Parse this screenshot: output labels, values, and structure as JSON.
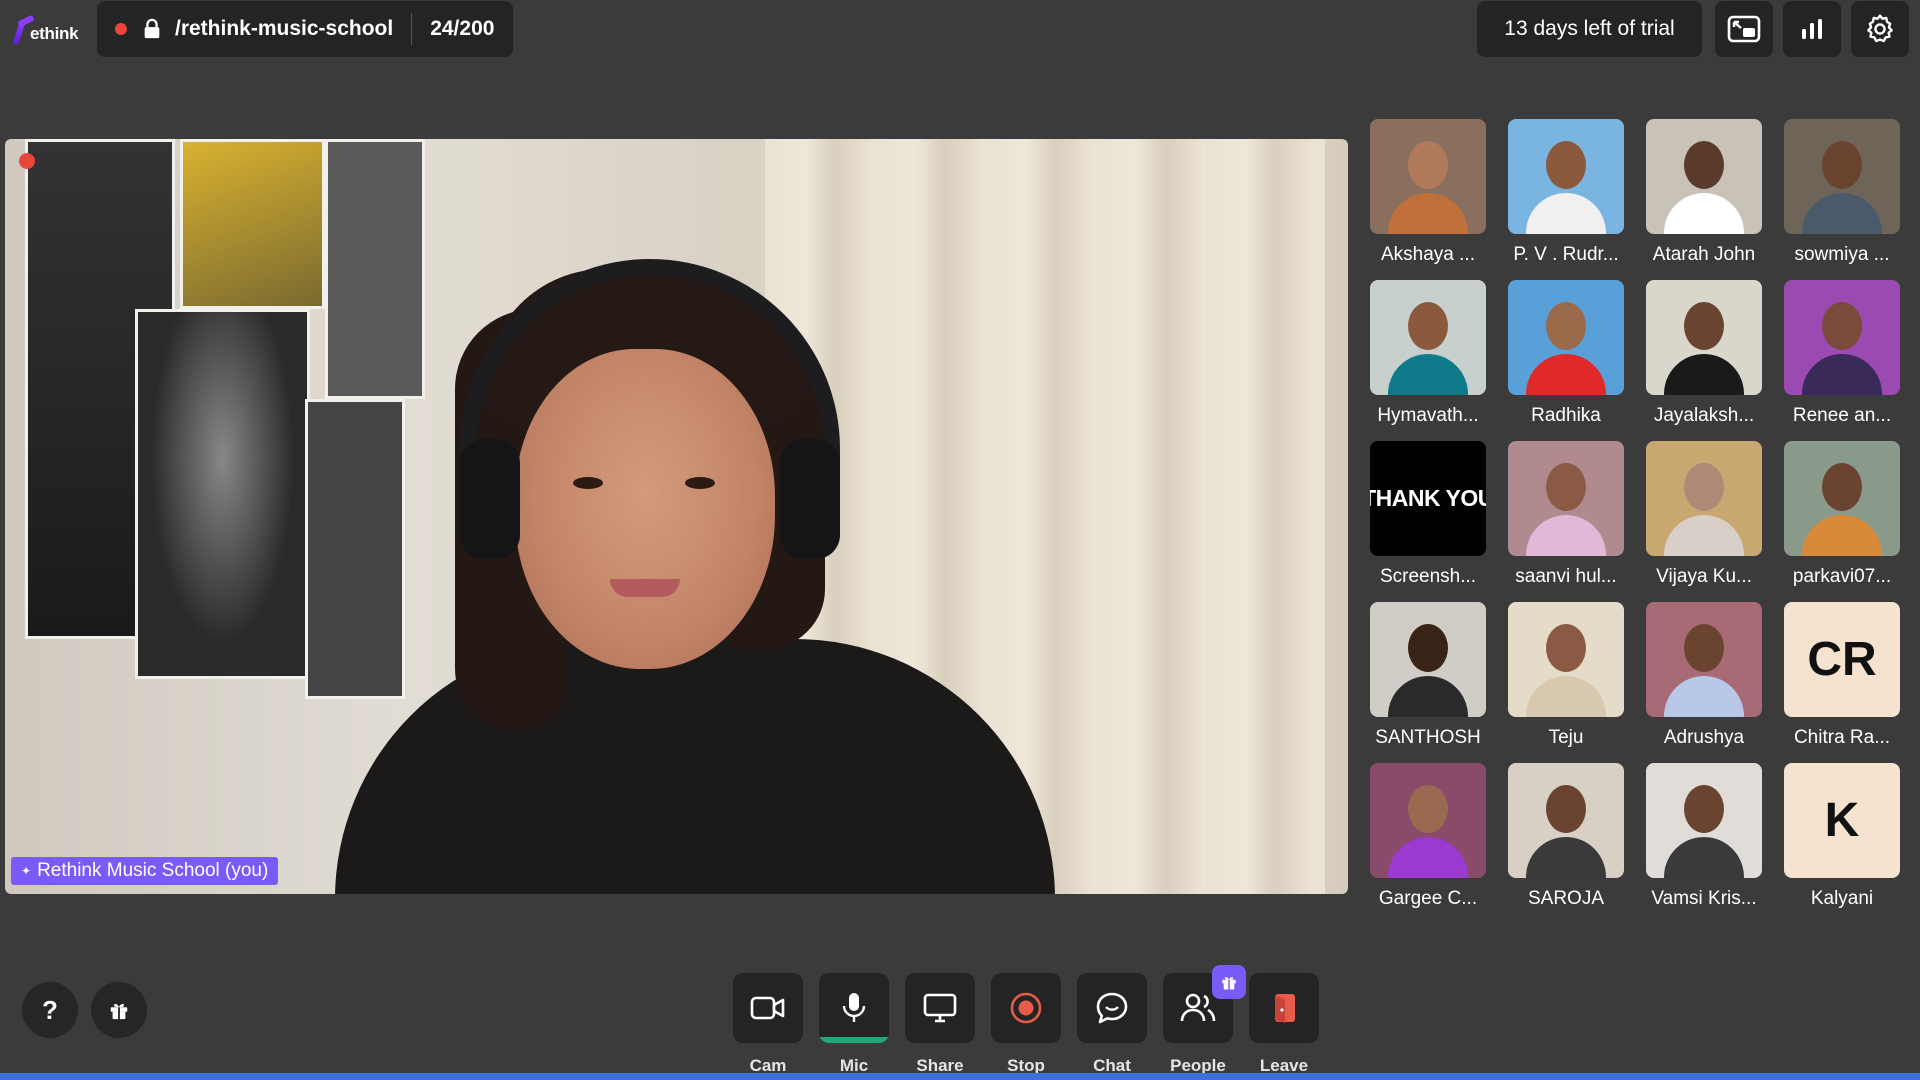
{
  "app": {
    "logo_text": "ethink"
  },
  "room": {
    "name": "/rethink-music-school",
    "count": "24/200"
  },
  "trial": {
    "text": "13 days left of trial"
  },
  "top_buttons": [
    "picture-in-picture-icon",
    "stats-icon",
    "settings-icon"
  ],
  "main_video": {
    "label": "Rethink Music School (you)",
    "recording": true
  },
  "participants": [
    {
      "name": "Akshaya ...",
      "kind": "video",
      "bg": "#8a6f5f",
      "skin": "#b07a5a",
      "shirt": "#c0703a"
    },
    {
      "name": "P. V . Rudr...",
      "kind": "video",
      "bg": "#7ab4e0",
      "skin": "#8b5a3c",
      "shirt": "#f0f0f0"
    },
    {
      "name": "Atarah John",
      "kind": "video",
      "bg": "#c9c2b8",
      "skin": "#5a3a2a",
      "shirt": "#ffffff"
    },
    {
      "name": "sowmiya ...",
      "kind": "video",
      "bg": "#6e6558",
      "skin": "#6b4430",
      "shirt": "#4a5a6a"
    },
    {
      "name": "Hymavath...",
      "kind": "video",
      "bg": "#c8d0cf",
      "skin": "#8b5a3c",
      "shirt": "#0f7a8a"
    },
    {
      "name": "Radhika",
      "kind": "video",
      "bg": "#5aa0d8",
      "skin": "#9a6a4a",
      "shirt": "#e02a2a"
    },
    {
      "name": "Jayalaksh...",
      "kind": "video",
      "bg": "#d9d6cc",
      "skin": "#6a4430",
      "shirt": "#1a1a1a"
    },
    {
      "name": "Renee an...",
      "kind": "video",
      "bg": "#9a4ab0",
      "skin": "#7a4a3a",
      "shirt": "#3a2a5a"
    },
    {
      "name": "Screensh...",
      "kind": "text",
      "text": "THANK YOU"
    },
    {
      "name": "saanvi hul...",
      "kind": "video",
      "bg": "#b08a8e",
      "skin": "#8a5a44",
      "shirt": "#e2b8d8"
    },
    {
      "name": "Vijaya Ku...",
      "kind": "video",
      "bg": "#c8a870",
      "skin": "#b08a78",
      "shirt": "#d8d0c8"
    },
    {
      "name": "parkavi07...",
      "kind": "video",
      "bg": "#8a9a8a",
      "skin": "#6a4430",
      "shirt": "#d88a3a"
    },
    {
      "name": "SANTHOSH",
      "kind": "video",
      "bg": "#d0ccc6",
      "skin": "#3a2418",
      "shirt": "#2a2a2a"
    },
    {
      "name": "Teju",
      "kind": "video",
      "bg": "#e4dcc8",
      "skin": "#8a5a44",
      "shirt": "#d8c8b0"
    },
    {
      "name": "Adrushya",
      "kind": "video",
      "bg": "#a86a74",
      "skin": "#6a4430",
      "shirt": "#b8c8e8"
    },
    {
      "name": "Chitra Ra...",
      "kind": "initials",
      "initials": "CR"
    },
    {
      "name": "Gargee C...",
      "kind": "video",
      "bg": "#8a4a6a",
      "skin": "#9a6a50",
      "shirt": "#9a3ad0"
    },
    {
      "name": "SAROJA",
      "kind": "video",
      "bg": "#d8d0c4",
      "skin": "#6a4430",
      "shirt": "#3a3a3a"
    },
    {
      "name": "Vamsi Kris...",
      "kind": "video",
      "bg": "#e0ddd8",
      "skin": "#6a4430",
      "shirt": "#3a3a3a"
    },
    {
      "name": "Kalyani",
      "kind": "initials",
      "initials": "K"
    }
  ],
  "left_buttons": [
    "help-icon",
    "gift-icon"
  ],
  "controls": [
    {
      "label": "Cam",
      "icon": "camera-icon",
      "active": false
    },
    {
      "label": "Mic",
      "icon": "microphone-icon",
      "active": true
    },
    {
      "label": "Share",
      "icon": "screen-share-icon",
      "active": false
    },
    {
      "label": "Stop",
      "icon": "record-stop-icon",
      "active": false
    },
    {
      "label": "Chat",
      "icon": "chat-icon",
      "active": false
    },
    {
      "label": "People",
      "icon": "people-icon",
      "active": false
    },
    {
      "label": "Leave",
      "icon": "leave-icon",
      "active": false
    }
  ],
  "colors": {
    "accent": "#7a5af8",
    "record": "#e8463d",
    "active_indicator": "#1ea97c",
    "leave": "#e85a4a"
  }
}
